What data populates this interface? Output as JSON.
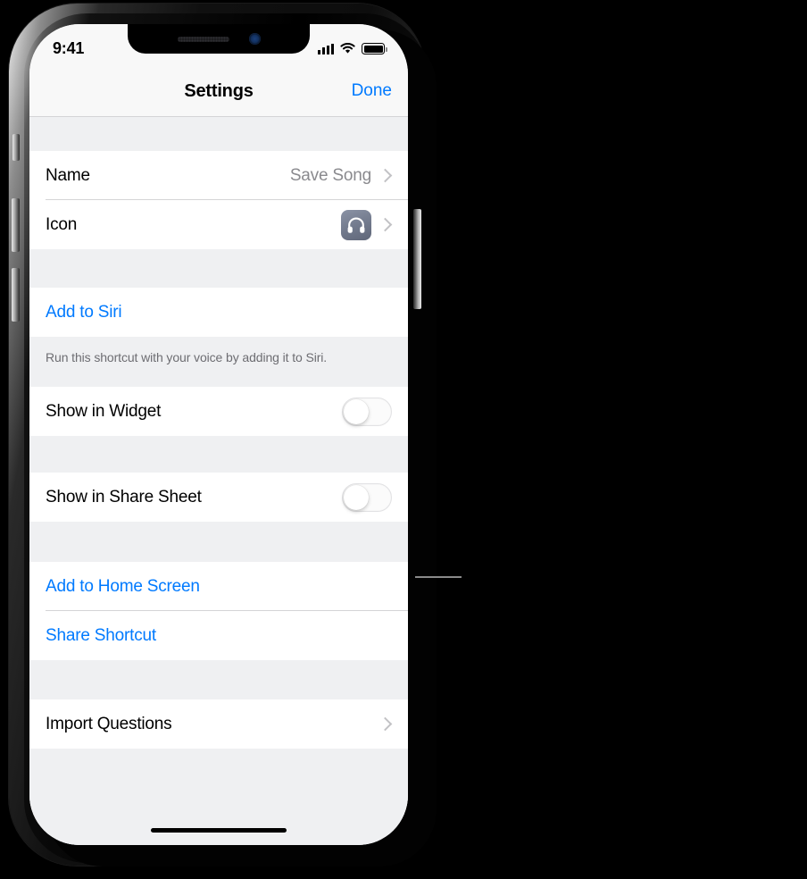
{
  "device": {
    "status_bar": {
      "time": "9:41",
      "cellular_icon": "signal-bars-icon",
      "wifi_icon": "wifi-icon",
      "battery_icon": "battery-full-icon"
    },
    "notch": {
      "speaker_icon": "speaker-grille-icon",
      "camera_icon": "front-camera-icon"
    },
    "home_indicator": "home-indicator"
  },
  "nav": {
    "title": "Settings",
    "done_label": "Done"
  },
  "sections": [
    {
      "id": "identity",
      "rows": [
        {
          "id": "name",
          "label": "Name",
          "value": "Save Song",
          "accessory": "chevron"
        },
        {
          "id": "icon",
          "label": "Icon",
          "value": "",
          "accessory": "app-icon-chevron",
          "icon": "headphones-icon"
        }
      ]
    },
    {
      "id": "siri",
      "rows": [
        {
          "id": "add-to-siri",
          "label": "Add to Siri",
          "style": "link"
        }
      ],
      "footer": "Run this shortcut with your voice by adding it to Siri."
    },
    {
      "id": "widget",
      "rows": [
        {
          "id": "show-in-widget",
          "label": "Show in Widget",
          "accessory": "toggle",
          "toggle_on": false
        }
      ]
    },
    {
      "id": "share-sheet",
      "rows": [
        {
          "id": "show-in-share-sheet",
          "label": "Show in Share Sheet",
          "accessory": "toggle",
          "toggle_on": false
        }
      ]
    },
    {
      "id": "actions",
      "rows": [
        {
          "id": "add-to-home-screen",
          "label": "Add to Home Screen",
          "style": "link"
        },
        {
          "id": "share-shortcut",
          "label": "Share Shortcut",
          "style": "link"
        }
      ]
    },
    {
      "id": "import",
      "rows": [
        {
          "id": "import-questions",
          "label": "Import Questions",
          "accessory": "chevron"
        }
      ]
    }
  ],
  "colors": {
    "accent_blue": "#007aff",
    "group_background": "#eff0f2",
    "cell_background": "#ffffff",
    "separator": "#d4d4d6",
    "secondary_text": "#8a8a8e",
    "footer_text": "#6d6d72",
    "app_icon_background": "#737b8e"
  },
  "annotation": {
    "leader_line": "callout-leader-line"
  }
}
